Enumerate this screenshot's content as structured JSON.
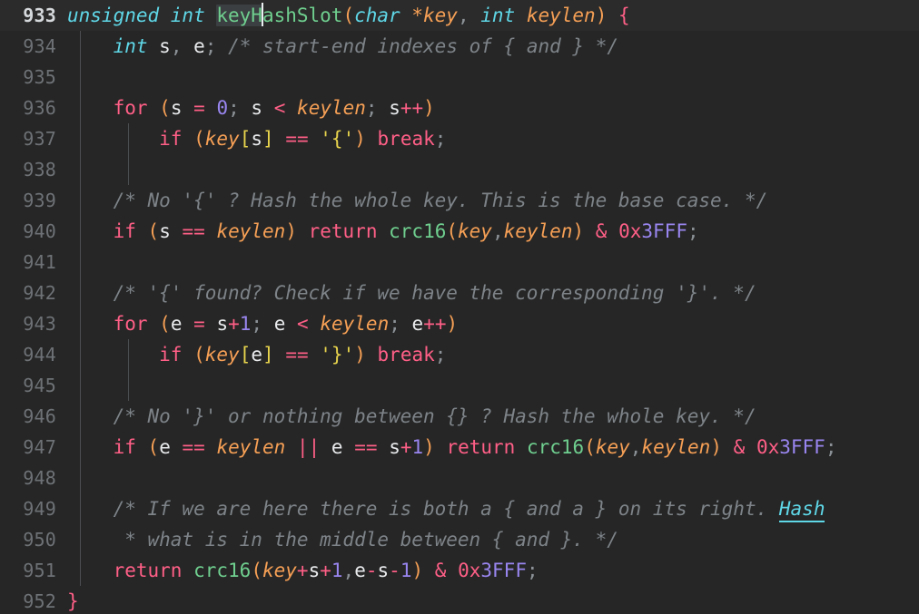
{
  "editor": {
    "language": "C",
    "background_color": "#262626",
    "active_line_background": "#2b2b2b",
    "first_visible_line": 933,
    "last_visible_line": 952,
    "cursor_line": 933,
    "cursor_column_token": "keyH",
    "highlighted_word": "keyH",
    "link_word": "Hash"
  },
  "theme": {
    "keyword": "#ff5f87",
    "type": "#5fd7e7",
    "function": "#6fcf8f",
    "parameter": "#f59f55",
    "bracket": "#e8d44d",
    "string": "#e8d44d",
    "number": "#9a86f0",
    "variable": "#e8eaec",
    "operator": "#8b9196",
    "comment": "#7d8388",
    "gutter_text": "#6e7276",
    "gutter_active_text": "#d6d9dc",
    "indent_guide": "#4a4d50",
    "caret": "#eceff1",
    "word_highlight": "#3b3f41",
    "link": "#5fd7e7"
  },
  "gutter": {
    "numbers": [
      "933",
      "934",
      "935",
      "936",
      "937",
      "938",
      "939",
      "940",
      "941",
      "942",
      "943",
      "944",
      "945",
      "946",
      "947",
      "948",
      "949",
      "950",
      "951",
      "952"
    ]
  },
  "lines": {
    "933": {
      "number": "933",
      "text": "unsigned int keyHashSlot(char *key, int keylen) {",
      "t_unsigned_int": "unsigned int",
      "t_space1": " ",
      "t_keyh": "keyH",
      "t_ashslot": "ashSlot",
      "t_lparen": "(",
      "t_char": "char",
      "t_space2": " ",
      "t_star_key": "*key",
      "t_comma": ",",
      "t_space3": " ",
      "t_int": "int",
      "t_space4": " ",
      "t_keylen": "keylen",
      "t_rparen": ")",
      "t_space5": " ",
      "t_lbrace": "{"
    },
    "934": {
      "number": "934",
      "text": "    int s, e; /* start-end indexes of { and } */",
      "t_indent": "    ",
      "t_int": "int",
      "t_space1": " ",
      "t_s": "s",
      "t_comma": ",",
      "t_space2": " ",
      "t_e": "e",
      "t_semi": ";",
      "t_space3": " ",
      "t_comment": "/* start-end indexes of { and } */"
    },
    "935": {
      "number": "935",
      "text": ""
    },
    "936": {
      "number": "936",
      "text": "    for (s = 0; s < keylen; s++)",
      "t_indent": "    ",
      "t_for": "for",
      "t_space1": " ",
      "t_lparen": "(",
      "t_s1": "s",
      "t_space2": " ",
      "t_eq": "=",
      "t_space3": " ",
      "t_zero": "0",
      "t_semi1": ";",
      "t_space4": " ",
      "t_s2": "s",
      "t_space5": " ",
      "t_lt": "<",
      "t_space6": " ",
      "t_keylen": "keylen",
      "t_semi2": ";",
      "t_space7": " ",
      "t_s3": "s",
      "t_incr": "++",
      "t_rparen": ")"
    },
    "937": {
      "number": "937",
      "text": "        if (key[s] == '{') break;",
      "t_indent": "        ",
      "t_if": "if",
      "t_space1": " ",
      "t_lparen": "(",
      "t_key": "key",
      "t_lbrk": "[",
      "t_s": "s",
      "t_rbrk": "]",
      "t_space2": " ",
      "t_eqeq": "==",
      "t_space3": " ",
      "t_str": "'{'",
      "t_rparen": ")",
      "t_space4": " ",
      "t_break": "break",
      "t_semi": ";"
    },
    "938": {
      "number": "938",
      "text": ""
    },
    "939": {
      "number": "939",
      "text": "    /* No '{' ? Hash the whole key. This is the base case. */",
      "t_indent": "    ",
      "t_comment": "/* No '{' ? Hash the whole key. This is the base case. */"
    },
    "940": {
      "number": "940",
      "text": "    if (s == keylen) return crc16(key,keylen) & 0x3FFF;",
      "t_indent": "    ",
      "t_if": "if",
      "t_space1": " ",
      "t_lparen": "(",
      "t_s": "s",
      "t_space2": " ",
      "t_eqeq": "==",
      "t_space3": " ",
      "t_keylen1": "keylen",
      "t_rparen": ")",
      "t_space4": " ",
      "t_return": "return",
      "t_space5": " ",
      "t_crc16": "crc16",
      "t_lparen2": "(",
      "t_key": "key",
      "t_comma": ",",
      "t_keylen2": "keylen",
      "t_rparen2": ")",
      "t_space6": " ",
      "t_amp": "&",
      "t_space7": " ",
      "t_0x": "0x",
      "t_3fff": "3FFF",
      "t_semi": ";"
    },
    "941": {
      "number": "941",
      "text": ""
    },
    "942": {
      "number": "942",
      "text": "    /* '{' found? Check if we have the corresponding '}'. */",
      "t_indent": "    ",
      "t_comment": "/* '{' found? Check if we have the corresponding '}'. */"
    },
    "943": {
      "number": "943",
      "text": "    for (e = s+1; e < keylen; e++)",
      "t_indent": "    ",
      "t_for": "for",
      "t_space1": " ",
      "t_lparen": "(",
      "t_e1": "e",
      "t_space2": " ",
      "t_eq": "=",
      "t_space3": " ",
      "t_s": "s",
      "t_plus": "+",
      "t_one": "1",
      "t_semi1": ";",
      "t_space4": " ",
      "t_e2": "e",
      "t_space5": " ",
      "t_lt": "<",
      "t_space6": " ",
      "t_keylen": "keylen",
      "t_semi2": ";",
      "t_space7": " ",
      "t_e3": "e",
      "t_incr": "++",
      "t_rparen": ")"
    },
    "944": {
      "number": "944",
      "text": "        if (key[e] == '}') break;",
      "t_indent": "        ",
      "t_if": "if",
      "t_space1": " ",
      "t_lparen": "(",
      "t_key": "key",
      "t_lbrk": "[",
      "t_e": "e",
      "t_rbrk": "]",
      "t_space2": " ",
      "t_eqeq": "==",
      "t_space3": " ",
      "t_str": "'}'",
      "t_rparen": ")",
      "t_space4": " ",
      "t_break": "break",
      "t_semi": ";"
    },
    "945": {
      "number": "945",
      "text": ""
    },
    "946": {
      "number": "946",
      "text": "    /* No '}' or nothing between {} ? Hash the whole key. */",
      "t_indent": "    ",
      "t_comment": "/* No '}' or nothing between {} ? Hash the whole key. */"
    },
    "947": {
      "number": "947",
      "text": "    if (e == keylen || e == s+1) return crc16(key,keylen) & 0x3FFF;",
      "t_indent": "    ",
      "t_if": "if",
      "t_space1": " ",
      "t_lparen": "(",
      "t_e1": "e",
      "t_space2": " ",
      "t_eqeq1": "==",
      "t_space3": " ",
      "t_keylen1": "keylen",
      "t_space4": " ",
      "t_or": "||",
      "t_space5": " ",
      "t_e2": "e",
      "t_space6": " ",
      "t_eqeq2": "==",
      "t_space7": " ",
      "t_s": "s",
      "t_plus": "+",
      "t_one": "1",
      "t_rparen": ")",
      "t_space8": " ",
      "t_return": "return",
      "t_space9": " ",
      "t_crc16": "crc16",
      "t_lparen2": "(",
      "t_key": "key",
      "t_comma": ",",
      "t_keylen2": "keylen",
      "t_rparen2": ")",
      "t_space10": " ",
      "t_amp": "&",
      "t_space11": " ",
      "t_0x": "0x",
      "t_3fff": "3FFF",
      "t_semi": ";"
    },
    "948": {
      "number": "948",
      "text": ""
    },
    "949": {
      "number": "949",
      "text": "    /* If we are here there is both a { and a } on its right. Hash",
      "t_indent": "    ",
      "t_comment": "/* If we are here there is both a { and a } on its right. ",
      "t_link": "Hash"
    },
    "950": {
      "number": "950",
      "text": "     * what is in the middle between { and }. */",
      "t_indent": "     ",
      "t_comment": "* what is in the middle between { and }. */"
    },
    "951": {
      "number": "951",
      "text": "    return crc16(key+s+1,e-s-1) & 0x3FFF;",
      "t_indent": "    ",
      "t_return": "return",
      "t_space1": " ",
      "t_crc16": "crc16",
      "t_lparen": "(",
      "t_key": "key",
      "t_plus1": "+",
      "t_s1": "s",
      "t_plus2": "+",
      "t_one1": "1",
      "t_comma": ",",
      "t_e": "e",
      "t_minus1": "-",
      "t_s2": "s",
      "t_minus2": "-",
      "t_one2": "1",
      "t_rparen": ")",
      "t_space2": " ",
      "t_amp": "&",
      "t_space3": " ",
      "t_0x": "0x",
      "t_3fff": "3FFF",
      "t_semi": ";"
    },
    "952": {
      "number": "952",
      "text": "}",
      "t_rbrace": "}"
    }
  }
}
